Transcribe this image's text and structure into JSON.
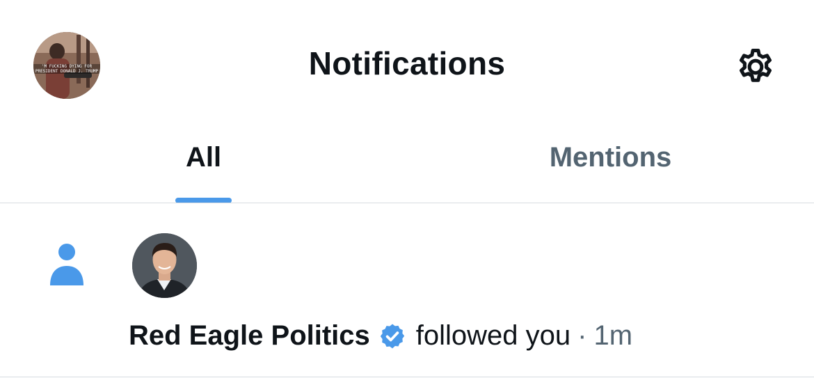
{
  "header": {
    "title": "Notifications",
    "avatar_caption": "'M FUCKING DYING FOR\nPRESIDENT DONALD J. TRUMP",
    "settings_icon": "gear-icon"
  },
  "tabs": [
    {
      "label": "All",
      "selected": true
    },
    {
      "label": "Mentions",
      "selected": false
    }
  ],
  "notification": {
    "type_icon": "person-icon",
    "user_name": "Red Eagle Politics",
    "verified": true,
    "action": "followed you",
    "separator": "·",
    "time": "1m"
  },
  "colors": {
    "accent": "#4a99e9",
    "text_primary": "#0f1419",
    "text_secondary": "#536471",
    "divider": "#d8dde1",
    "verified_badge": "#4a99e9"
  }
}
